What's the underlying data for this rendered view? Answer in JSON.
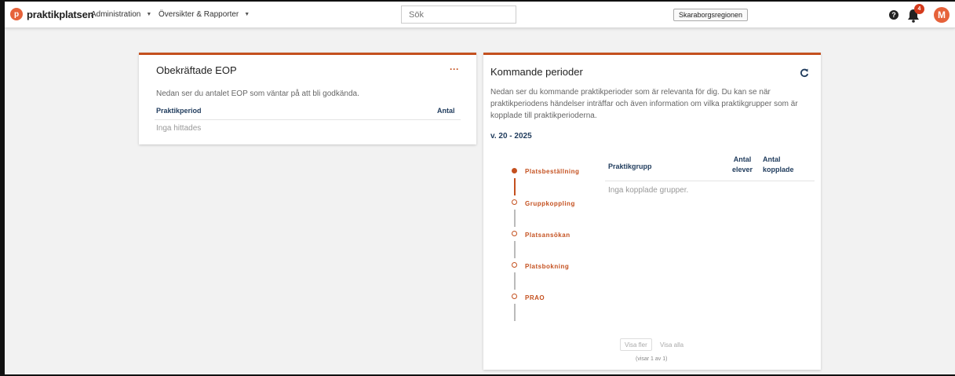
{
  "header": {
    "brand": "praktikplatsen",
    "logo_glyph": "p",
    "menu_admin": "Administration",
    "menu_reports": "Översikter & Rapporter",
    "search_placeholder": "Sök",
    "region": "Skaraborgsregionen",
    "help_glyph": "?",
    "notification_count": "4",
    "avatar_initial": "M"
  },
  "eop_card": {
    "title": "Obekräftade EOP",
    "menu_glyph": "···",
    "description": "Nedan ser du antalet EOP som väntar på att bli godkända.",
    "columns": [
      "Praktikperiod",
      "Antal"
    ],
    "empty_text": "Inga hittades"
  },
  "periods_card": {
    "title": "Kommande perioder",
    "description": "Nedan ser du kommande praktikperioder som är relevanta för dig. Du kan se när praktikperiodens händelser inträffar och även information om vilka praktikgrupper som är kopplade till praktikperioderna.",
    "week": "v. 20 - 2025",
    "steps": [
      {
        "label": "Platsbeställning",
        "active": true
      },
      {
        "label": "Gruppkoppling",
        "active": false
      },
      {
        "label": "Platsansökan",
        "active": false
      },
      {
        "label": "Platsbokning",
        "active": false
      },
      {
        "label": "PRAO",
        "active": false
      }
    ],
    "columns": {
      "group": "Praktikgrupp",
      "students_l1": "Antal",
      "students_l2": "elever",
      "linked_l1": "Antal",
      "linked_l2": "kopplade"
    },
    "empty_text": "Inga kopplade grupper.",
    "show_more": "Visa fler",
    "show_all": "Visa alla",
    "showing": "(visar 1 av 1)"
  },
  "colors": {
    "accent": "#c4501f",
    "brand": "#e6623a",
    "header_text": "#1f3b5c"
  }
}
